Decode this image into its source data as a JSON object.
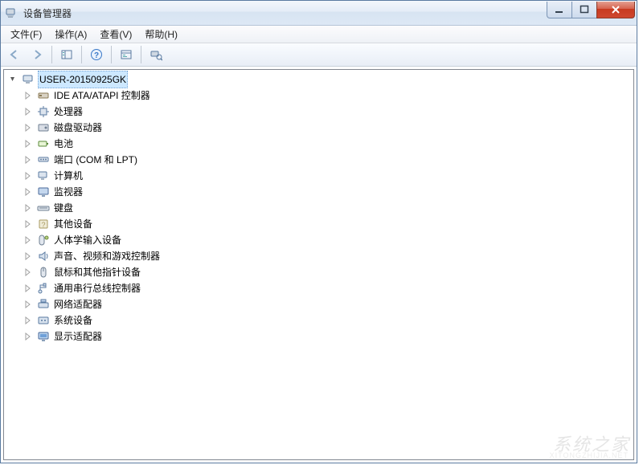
{
  "window": {
    "title": "设备管理器"
  },
  "menu": {
    "file": "文件(F)",
    "action": "操作(A)",
    "view": "查看(V)",
    "help": "帮助(H)"
  },
  "tree": {
    "root": {
      "label": "USER-20150925GK",
      "expanded": true
    },
    "children": [
      {
        "label": "IDE ATA/ATAPI 控制器",
        "icon": "ide"
      },
      {
        "label": "处理器",
        "icon": "cpu"
      },
      {
        "label": "磁盘驱动器",
        "icon": "disk"
      },
      {
        "label": "电池",
        "icon": "battery"
      },
      {
        "label": "端口 (COM 和 LPT)",
        "icon": "port"
      },
      {
        "label": "计算机",
        "icon": "computer"
      },
      {
        "label": "监视器",
        "icon": "monitor"
      },
      {
        "label": "键盘",
        "icon": "keyboard"
      },
      {
        "label": "其他设备",
        "icon": "other"
      },
      {
        "label": "人体学输入设备",
        "icon": "hid"
      },
      {
        "label": "声音、视频和游戏控制器",
        "icon": "sound"
      },
      {
        "label": "鼠标和其他指针设备",
        "icon": "mouse"
      },
      {
        "label": "通用串行总线控制器",
        "icon": "usb"
      },
      {
        "label": "网络适配器",
        "icon": "network"
      },
      {
        "label": "系统设备",
        "icon": "system"
      },
      {
        "label": "显示适配器",
        "icon": "display"
      }
    ]
  },
  "watermark": {
    "main": "系统之家",
    "sub": "XITONGZHIJIA.NET"
  }
}
